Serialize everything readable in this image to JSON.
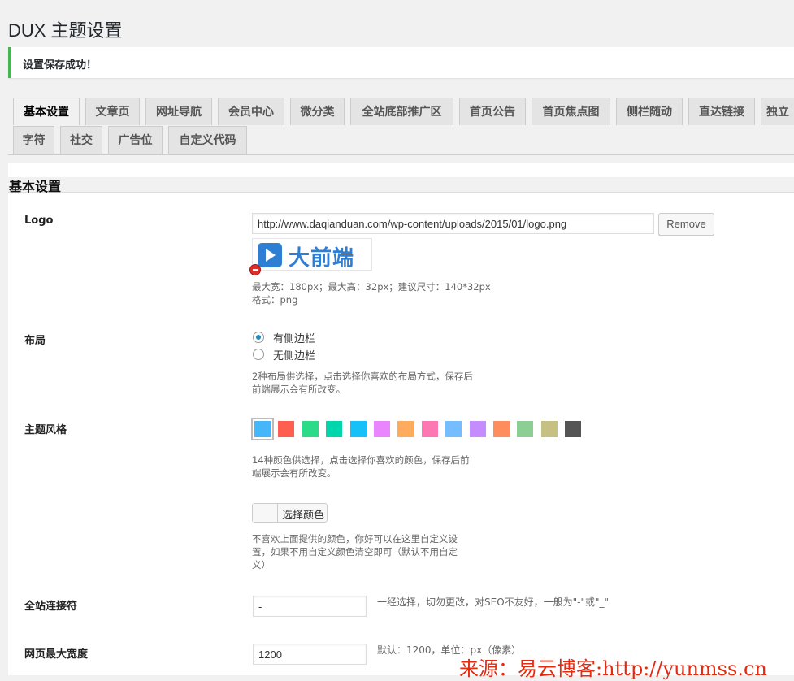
{
  "page": {
    "title": "DUX 主题设置"
  },
  "notice": {
    "message": "设置保存成功！"
  },
  "tabs": [
    {
      "label": "基本设置",
      "active": true
    },
    {
      "label": "文章页"
    },
    {
      "label": "网址导航"
    },
    {
      "label": "会员中心"
    },
    {
      "label": "微分类"
    },
    {
      "label": "全站底部推广区"
    },
    {
      "label": "首页公告"
    },
    {
      "label": "首页焦点图"
    },
    {
      "label": "侧栏随动"
    },
    {
      "label": "直达链接"
    },
    {
      "label": "独立"
    },
    {
      "label": "字符"
    },
    {
      "label": "社交"
    },
    {
      "label": "广告位"
    },
    {
      "label": "自定义代码"
    }
  ],
  "section": {
    "title": "基本设置"
  },
  "logo": {
    "label": "Logo",
    "url_value": "http://www.daqianduan.com/wp-content/uploads/2015/01/logo.png",
    "remove_label": "Remove",
    "preview_text": "大前端",
    "brand_color": "#2e7fd3",
    "desc_line1": "最大宽：180px；最大高：32px；建议尺寸：140*32px",
    "desc_line2": "格式：png"
  },
  "layout": {
    "label": "布局",
    "options": [
      {
        "label": "有侧边栏",
        "checked": true
      },
      {
        "label": "无侧边栏",
        "checked": false
      }
    ],
    "desc_line1": "2种布局供选择，点击选择你喜欢的布局方式，保存后",
    "desc_line2": "前端展示会有所改变。"
  },
  "theme": {
    "label": "主题风格",
    "swatches": [
      {
        "color": "#45B6F7",
        "selected": true
      },
      {
        "color": "#FF5E52"
      },
      {
        "color": "#2CDB87"
      },
      {
        "color": "#00D6AC"
      },
      {
        "color": "#16C0F8"
      },
      {
        "color": "#EA84FF"
      },
      {
        "color": "#FDAC5F"
      },
      {
        "color": "#FD77B2"
      },
      {
        "color": "#76BDFF"
      },
      {
        "color": "#C38CFF"
      },
      {
        "color": "#FF8C5C"
      },
      {
        "color": "#8DCE94"
      },
      {
        "color": "#C6C085"
      },
      {
        "color": "#555555"
      }
    ],
    "desc_line1": "14种颜色供选择，点击选择你喜欢的颜色，保存后前",
    "desc_line2": "端展示会有所改变。",
    "picker_label": "选择颜色",
    "custom_desc_line1": "不喜欢上面提供的颜色，你好可以在这里自定义设",
    "custom_desc_line2": "置，如果不用自定义颜色清空即可（默认不用自定",
    "custom_desc_line3": "义）"
  },
  "connector": {
    "label": "全站连接符",
    "value": "-",
    "desc": "一经选择，切勿更改，对SEO不友好，一般为\"-\"或\"_\""
  },
  "max_width": {
    "label": "网页最大宽度",
    "value": "1200",
    "desc": "默认：1200，单位：px（像素）"
  },
  "watermark": {
    "text": "来源：易云博客:http://yunmss.cn"
  }
}
